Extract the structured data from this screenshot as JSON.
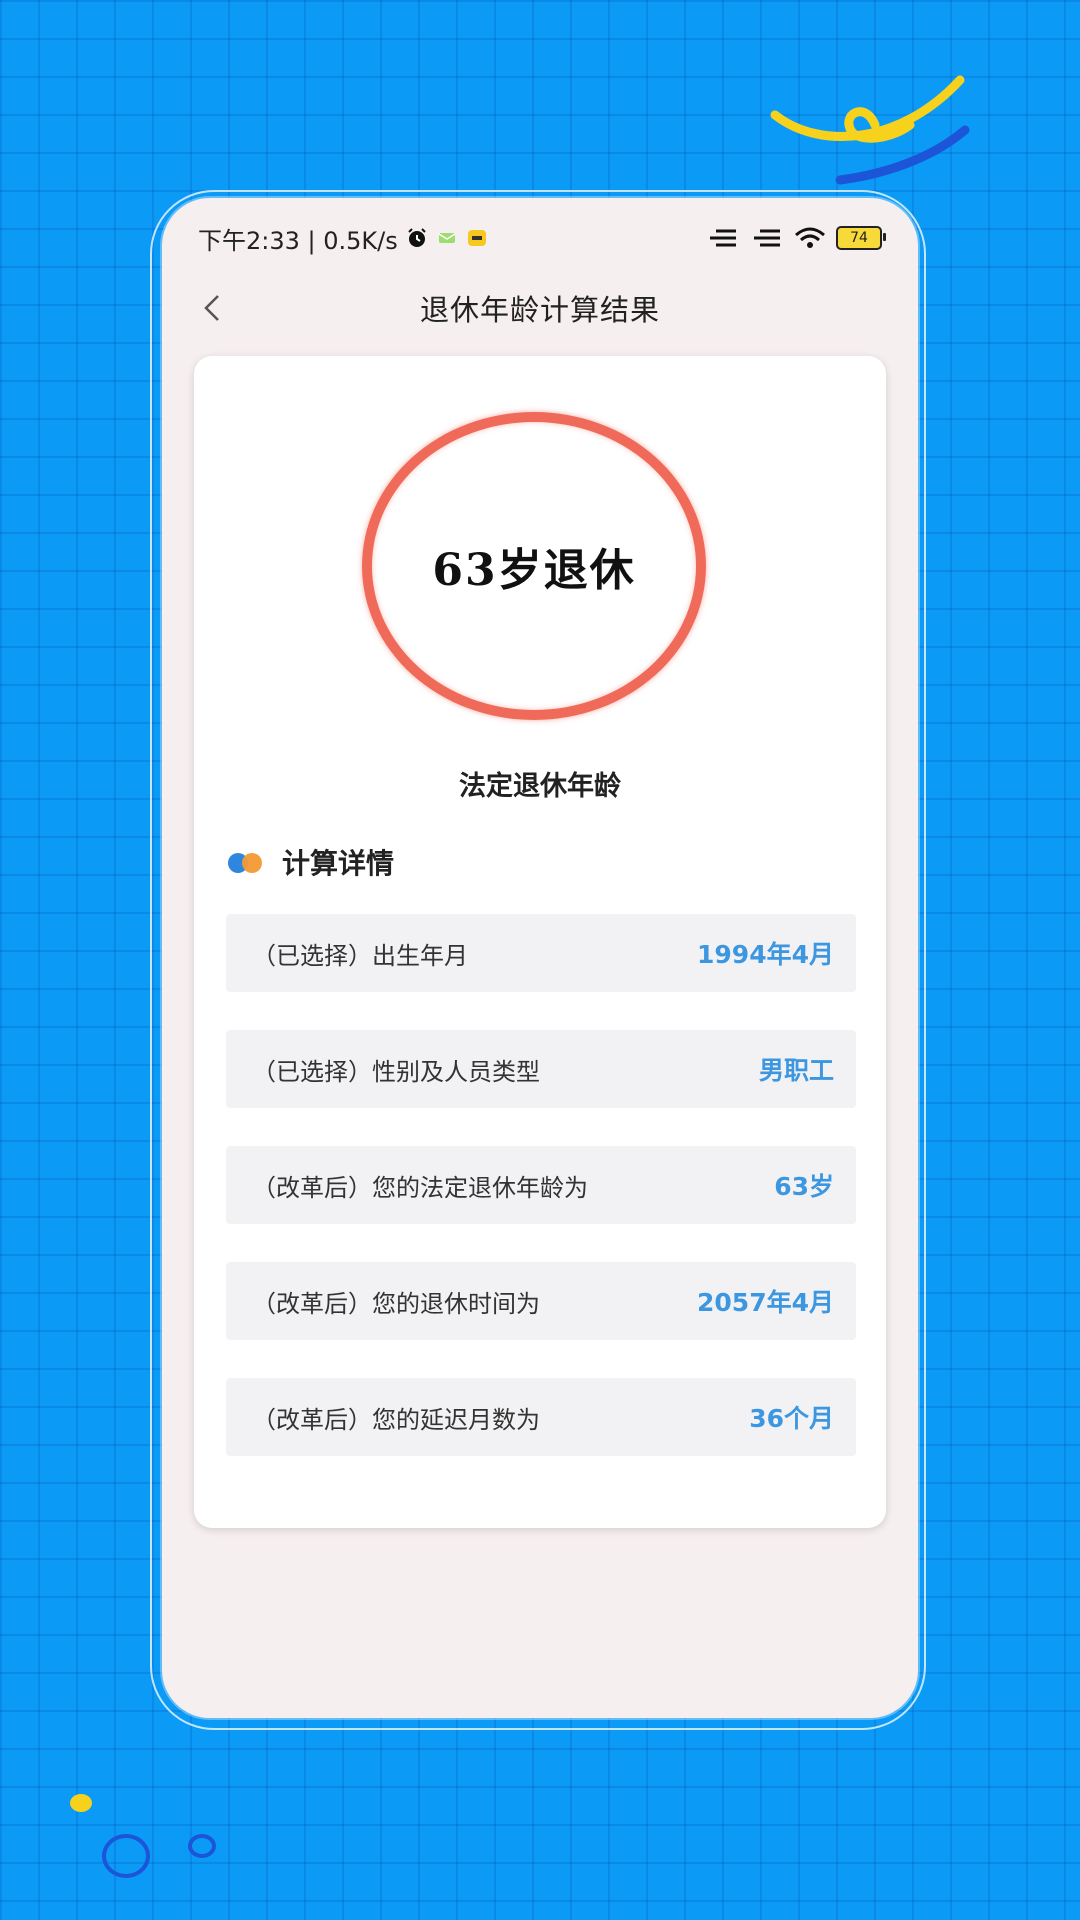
{
  "statusbar": {
    "time_speed": "下午2:33 | 0.5K/s",
    "battery": "74",
    "icons": [
      "alarm-icon",
      "message-icon",
      "meituan-icon",
      "signal-icon",
      "signal-icon",
      "wifi-icon",
      "battery-icon"
    ]
  },
  "navbar": {
    "back_icon": "chevron-left-icon",
    "title": "退休年龄计算结果"
  },
  "result": {
    "value": "63岁退休",
    "caption": "法定退休年龄"
  },
  "details": {
    "title": "计算详情",
    "rows": [
      {
        "label": "（已选择）出生年月",
        "value": "1994年4月"
      },
      {
        "label": "（已选择）性别及人员类型",
        "value": "男职工"
      },
      {
        "label": "（改革后）您的法定退休年龄为",
        "value": "63岁"
      },
      {
        "label": "（改革后）您的退休时间为",
        "value": "2057年4月"
      },
      {
        "label": "（改革后）您的延迟月数为",
        "value": "36个月"
      }
    ]
  },
  "colors": {
    "background": "#0C9AF7",
    "ring": "#F06A5A",
    "value_text": "#3D97E0",
    "dot_blue": "#2E86DE",
    "dot_orange": "#F39A35"
  }
}
